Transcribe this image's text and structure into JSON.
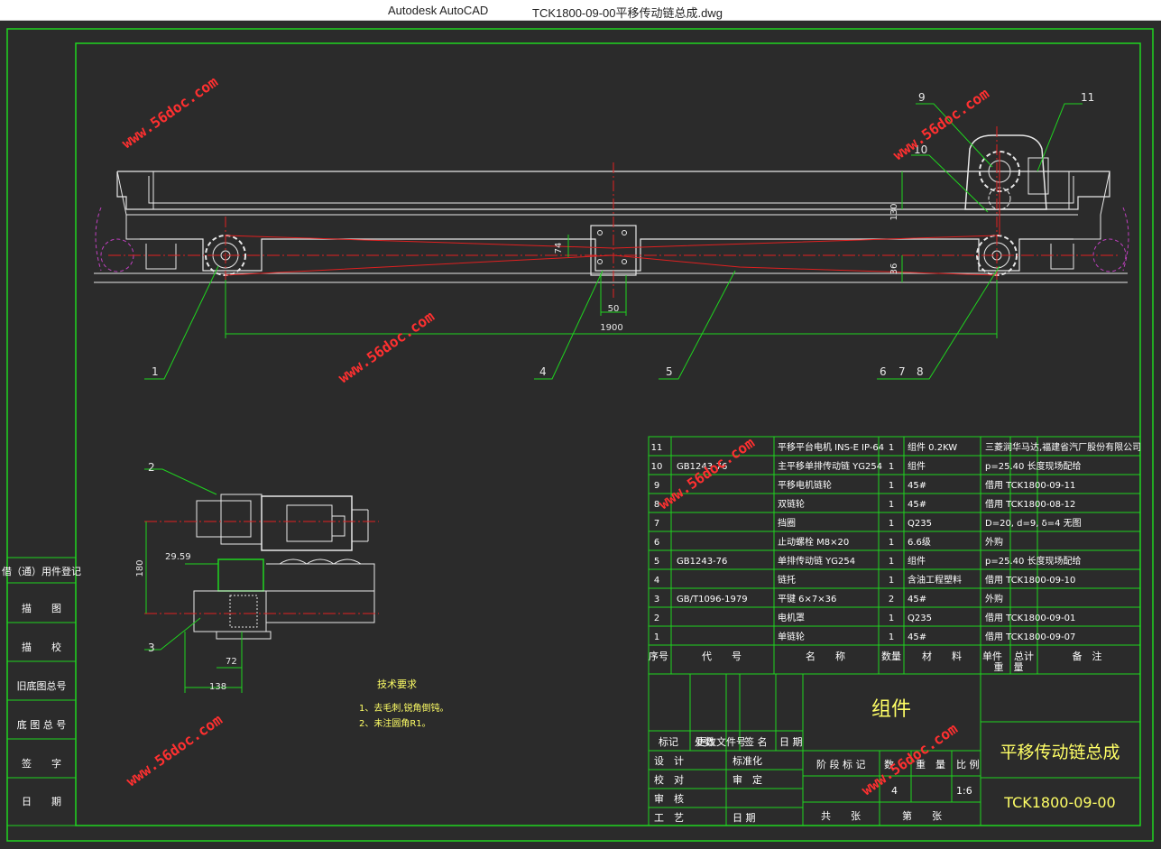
{
  "window": {
    "app_name": "Autodesk AutoCAD",
    "doc_title": "TCK1800-09-00平移传动链总成.dwg"
  },
  "watermark": "www.56doc.com",
  "callouts": [
    "1",
    "2",
    "3",
    "4",
    "5",
    "6",
    "7",
    "8",
    "9",
    "10",
    "11"
  ],
  "dimensions": {
    "d1900": "1900",
    "d50": "50",
    "d74": "74",
    "d130": "130",
    "d36": "36",
    "d180": "180",
    "d29": "29.59",
    "d72": "72",
    "d138": "138"
  },
  "tech_req": {
    "title": "技术要求",
    "items": [
      "1、去毛刺,锐角倒钝。",
      "2、未注圆角R1。"
    ]
  },
  "left_stamp": [
    "借（通）用件登记",
    "描　　图",
    "描　　校",
    "旧底图总号",
    "底 图 总 号",
    "签　　字",
    "日　　期"
  ],
  "bom": {
    "rows": [
      {
        "no": "11",
        "code": "",
        "name": "平移平台电机 INS-E IP-64",
        "qty": "1",
        "material": "组件 0.2KW",
        "weight": "",
        "remark": "三菱润华马达,福建省汽厂股份有限公司"
      },
      {
        "no": "10",
        "code": "GB1243-76",
        "name": "主平移单排传动链 YG254",
        "qty": "1",
        "material": "组件",
        "weight": "",
        "remark": "p=25.40 长度现场配给"
      },
      {
        "no": "9",
        "code": "",
        "name": "平移电机链轮",
        "qty": "1",
        "material": "45#",
        "weight": "",
        "remark": "借用 TCK1800-09-11"
      },
      {
        "no": "8",
        "code": "",
        "name": "双链轮",
        "qty": "1",
        "material": "45#",
        "weight": "",
        "remark": "借用 TCK1800-08-12"
      },
      {
        "no": "7",
        "code": "",
        "name": "挡圈",
        "qty": "1",
        "material": "Q235",
        "weight": "",
        "remark": "D=20, d=9, δ=4 无图"
      },
      {
        "no": "6",
        "code": "",
        "name": "止动螺栓 M8×20",
        "qty": "1",
        "material": "6.6级",
        "weight": "",
        "remark": "外购"
      },
      {
        "no": "5",
        "code": "GB1243-76",
        "name": "单排传动链 YG254",
        "qty": "1",
        "material": "组件",
        "weight": "",
        "remark": "p=25.40 长度现场配给"
      },
      {
        "no": "4",
        "code": "",
        "name": "链托",
        "qty": "1",
        "material": "含油工程塑料",
        "weight": "",
        "remark": "借用 TCK1800-09-10"
      },
      {
        "no": "3",
        "code": "GB/T1096-1979",
        "name": "平键 6×7×36",
        "qty": "2",
        "material": "45#",
        "weight": "",
        "remark": "外购"
      },
      {
        "no": "2",
        "code": "",
        "name": "电机罩",
        "qty": "1",
        "material": "Q235",
        "weight": "",
        "remark": "借用 TCK1800-09-01"
      },
      {
        "no": "1",
        "code": "",
        "name": "单链轮",
        "qty": "1",
        "material": "45#",
        "weight": "",
        "remark": "借用 TCK1800-09-07"
      }
    ],
    "header": {
      "no": "序号",
      "code": "代　　号",
      "name": "名　　称",
      "qty": "数量",
      "material": "材　　料",
      "unit": "单件",
      "total": "总计",
      "weight": "重　量",
      "remark": "备　注"
    }
  },
  "title_block": {
    "assembly_type": "组件",
    "drawing_name": "平移传动链总成",
    "drawing_no": "TCK1800-09-00",
    "rev_labels": [
      "标记",
      "处数",
      "更改文件号",
      "签 名",
      "日 期"
    ],
    "approvals": [
      "设　计",
      "校　对",
      "审　核",
      "工　艺"
    ],
    "approvals2": [
      "标准化",
      "审　定",
      "",
      "日 期"
    ],
    "stage": "阶 段 标 记",
    "weight": "重　量",
    "scale_label": "比 例",
    "count_label": "数",
    "count": "4",
    "scale": "1:6",
    "sheets": "共　　张",
    "sheet": "第　　张"
  },
  "colors": {
    "bg": "#2b2b2b",
    "line": "#e8e8e8",
    "dim": "#1fd41f",
    "center": "#e02020",
    "hidden": "#c040c0",
    "watermark": "#ff3030",
    "frame": "#1fd41f"
  }
}
